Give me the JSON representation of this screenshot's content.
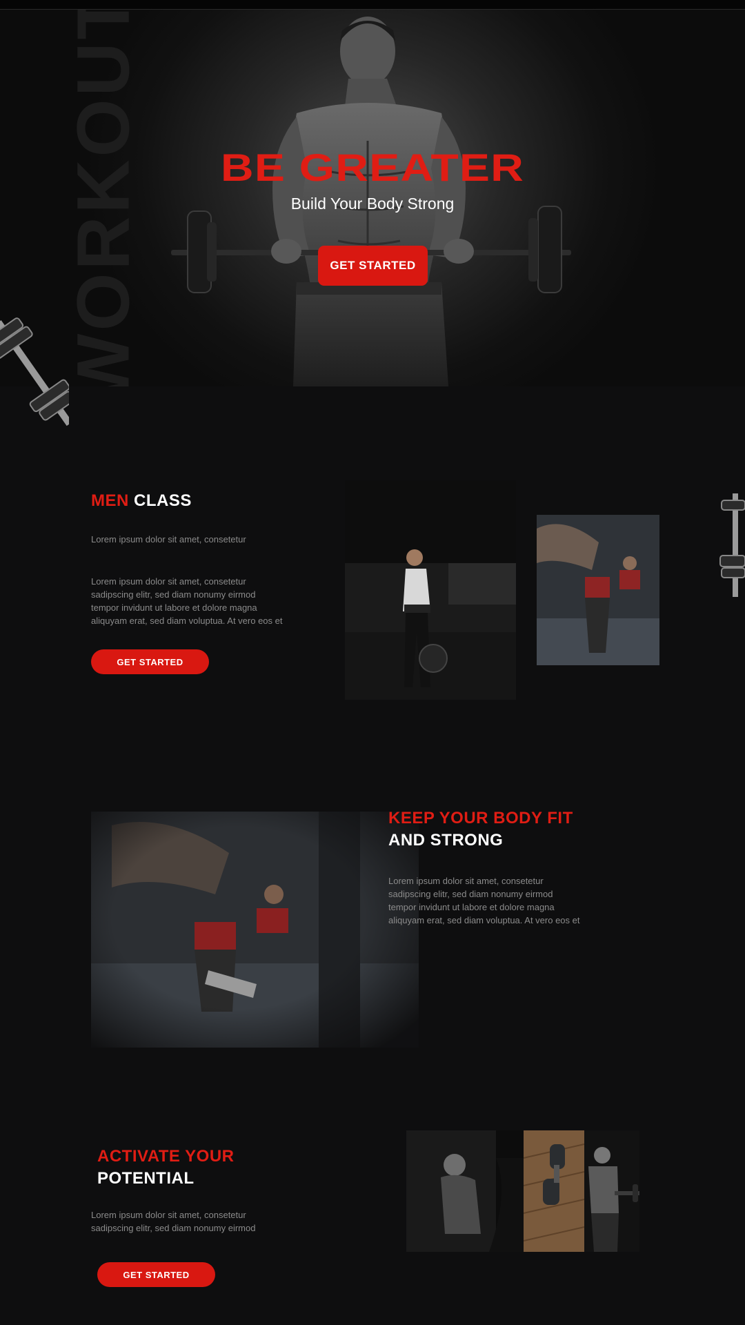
{
  "hero": {
    "watermark": "WORKOUT",
    "title": "BE GREATER",
    "subtitle": "Build Your Body Strong",
    "cta": "GET STARTED"
  },
  "men_class": {
    "title_accent": "MEN",
    "title_rest": "CLASS",
    "intro": "Lorem ipsum dolor sit amet, consetetur",
    "body_lines": [
      "Lorem ipsum dolor sit amet, consetetur",
      "sadipscing elitr, sed diam nonumy eirmod",
      "tempor invidunt ut labore et dolore magna",
      "aliquyam erat, sed diam voluptua. At vero eos et"
    ],
    "cta": "GET STARTED"
  },
  "fit_strong": {
    "title_line1": "KEEP YOUR BODY FIT",
    "title_line2": "AND STRONG",
    "body_lines": [
      "Lorem ipsum dolor sit amet, consetetur",
      "sadipscing elitr, sed diam nonumy eirmod",
      "tempor invidunt ut labore et dolore magna",
      "aliquyam erat, sed diam voluptua. At vero eos et"
    ]
  },
  "activate": {
    "title_line1": "ACTIVATE YOUR",
    "title_line2": "POTENTIAL",
    "body_lines": [
      "Lorem ipsum dolor sit amet, consetetur",
      "sadipscing elitr, sed diam nonumy eirmod"
    ],
    "cta": "GET STARTED"
  },
  "colors": {
    "background": "#0e0e0f",
    "accent": "#e01d14",
    "button": "#d91811",
    "body_text": "#8b8b8b"
  },
  "icons": [
    "dumbbell-icon",
    "barbell-icon"
  ]
}
